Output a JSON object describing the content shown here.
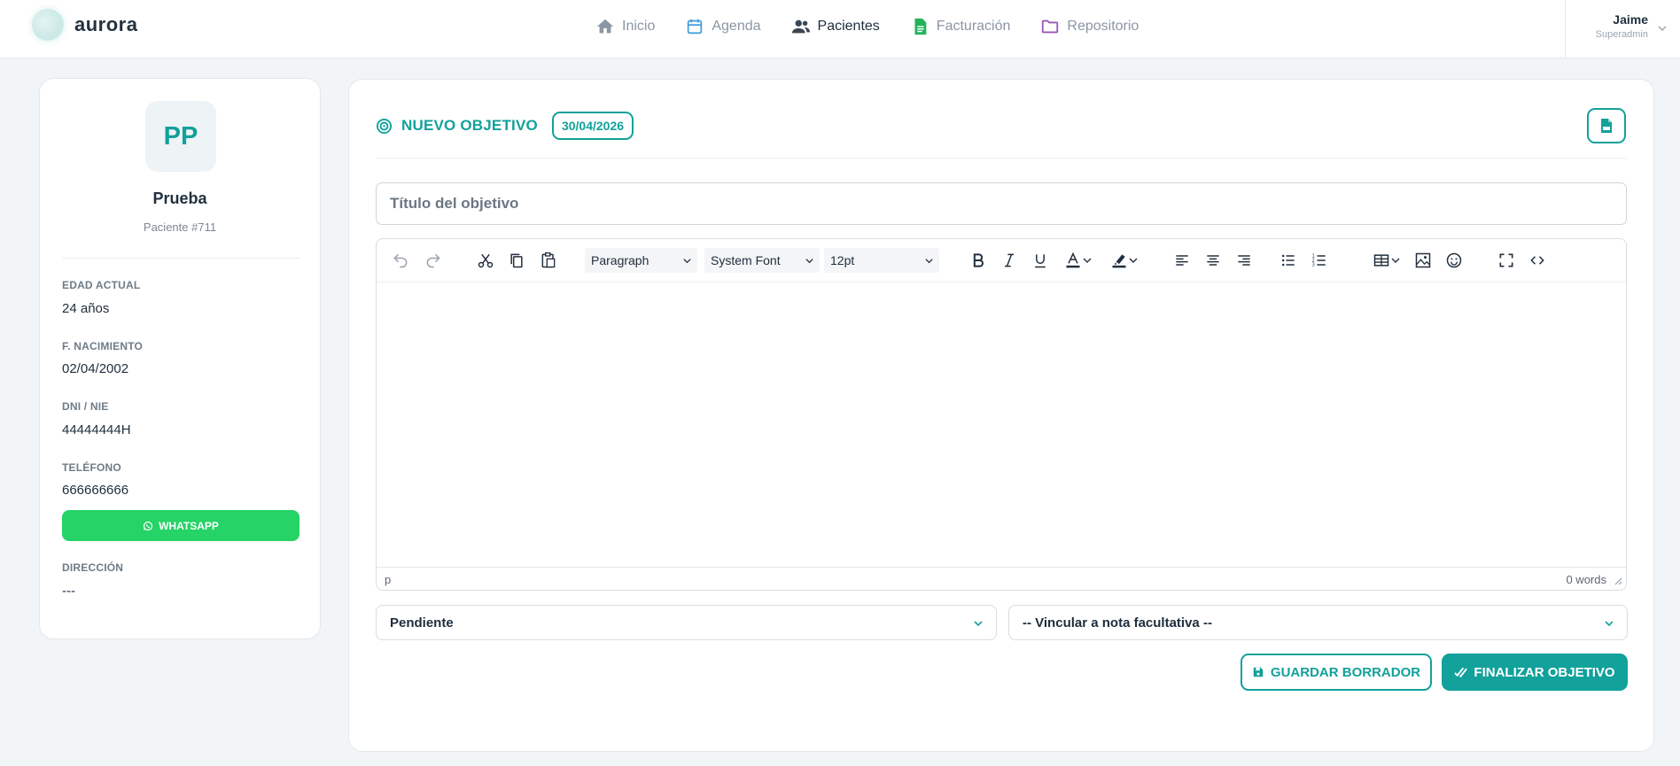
{
  "app": {
    "logo_text": "aurora"
  },
  "nav": {
    "items": [
      {
        "label": "Inicio",
        "icon": "home-icon",
        "active": false
      },
      {
        "label": "Agenda",
        "icon": "calendar-icon",
        "active": false
      },
      {
        "label": "Pacientes",
        "icon": "users-icon",
        "active": true
      },
      {
        "label": "Facturación",
        "icon": "invoice-icon",
        "active": false
      },
      {
        "label": "Repositorio",
        "icon": "folder-icon",
        "active": false
      }
    ]
  },
  "user": {
    "name": "Jaime",
    "role": "Superadmin"
  },
  "patient": {
    "initials": "PP",
    "name": "Prueba",
    "id_label": "Paciente #711",
    "fields": {
      "age": {
        "label": "EDAD ACTUAL",
        "value": "24 años"
      },
      "birth": {
        "label": "F. NACIMIENTO",
        "value": "02/04/2002"
      },
      "dni": {
        "label": "DNI / NIE",
        "value": "44444444H"
      },
      "phone": {
        "label": "TELÉFONO",
        "value": "666666666"
      },
      "address": {
        "label": "DIRECCIÓN",
        "value": "---"
      }
    },
    "whatsapp_label": "WHATSAPP"
  },
  "objective": {
    "heading": "NUEVO OBJETIVO",
    "date": "30/04/2026",
    "title_placeholder": "Título del objetivo",
    "editor": {
      "block_format": "Paragraph",
      "font_family": "System Font",
      "font_size": "12pt",
      "status_path": "p",
      "word_count": "0 words"
    },
    "status_select": "Pendiente",
    "link_select": "-- Vincular a nota facultativa --",
    "save_draft_label": "GUARDAR BORRADOR",
    "finalize_label": "FINALIZAR OBJETIVO"
  },
  "colors": {
    "accent": "#12a19b",
    "whatsapp": "#25d366",
    "calendar": "#4a9fe0",
    "invoice": "#22b35a",
    "folder": "#9b59b6"
  }
}
